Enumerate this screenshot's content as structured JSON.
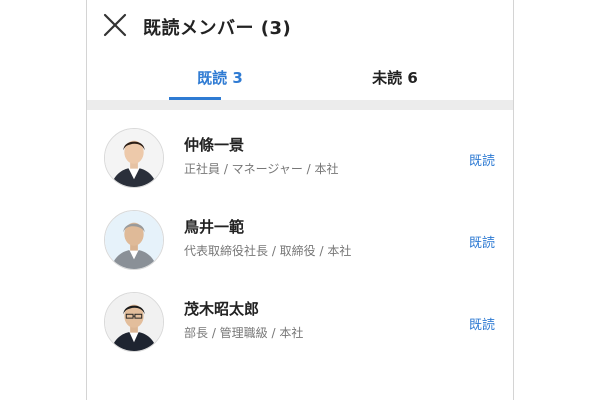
{
  "header": {
    "title": "既読メンバー (3)",
    "close_icon": "close-icon"
  },
  "tabs": [
    {
      "label": "既読 3",
      "active": true
    },
    {
      "label": "未読 6",
      "active": false
    }
  ],
  "colors": {
    "accent": "#2f7bd3",
    "divider": "#ececec"
  },
  "members": [
    {
      "name": "仲條一景",
      "subtitle": "正社員 / マネージャー / 本社",
      "status": "既読"
    },
    {
      "name": "鳥井一範",
      "subtitle": "代表取締役社長 / 取締役 / 本社",
      "status": "既読"
    },
    {
      "name": "茂木昭太郎",
      "subtitle": "部長 / 管理職級 / 本社",
      "status": "既読"
    }
  ]
}
